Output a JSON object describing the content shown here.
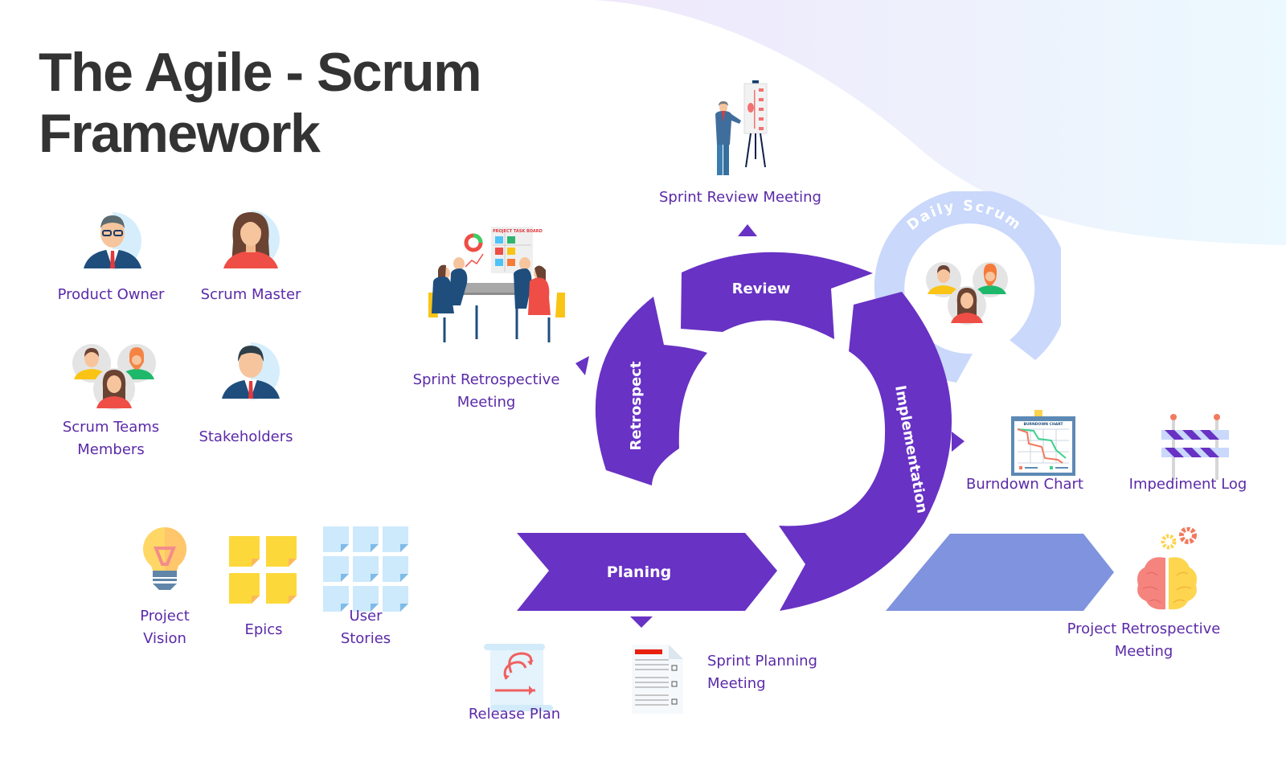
{
  "title": {
    "line1": "The Agile - Scrum",
    "line2": "Framework"
  },
  "colors": {
    "primary": "#6832c4",
    "label_text": "#5b2aa8",
    "title_text": "#333333",
    "daily_scrum_ring": "#c9d8fb",
    "release_arrow": "#7f93de"
  },
  "roles": [
    {
      "label": "Product Owner",
      "icon": "product-owner-avatar"
    },
    {
      "label": "Scrum Master",
      "icon": "scrum-master-avatar"
    },
    {
      "label_line1": "Scrum Teams",
      "label_line2": "Members",
      "icon": "team-members-avatars"
    },
    {
      "label": "Stakeholders",
      "icon": "stakeholder-avatar"
    }
  ],
  "artifacts": [
    {
      "label_line1": "Project",
      "label_line2": "Vision",
      "icon": "lightbulb"
    },
    {
      "label": "Epics",
      "icon": "sticky-notes-yellow"
    },
    {
      "label_line1": "User",
      "label_line2": "Stories",
      "icon": "sticky-notes-blue"
    }
  ],
  "cycle": {
    "planning": "Planing",
    "implementation": "Implementation",
    "review": "Review",
    "retrospect": "Retrospect",
    "daily_scrum": "Daily Scrum"
  },
  "meetings": {
    "sprint_review": "Sprint Review Meeting",
    "sprint_retro_line1": "Sprint Retrospective",
    "sprint_retro_line2": "Meeting",
    "sprint_planning_line1": "Sprint Planning",
    "sprint_planning_line2": "Meeting",
    "project_retro_line1": "Project Retrospective",
    "project_retro_line2": "Meeting"
  },
  "outputs": {
    "burndown": "Burndown Chart",
    "burndown_board_title": "BURNDOWN CHART",
    "impediment": "Impediment Log",
    "release_plan": "Release Plan",
    "task_board_title": "PROJECT TASK BOARD"
  }
}
